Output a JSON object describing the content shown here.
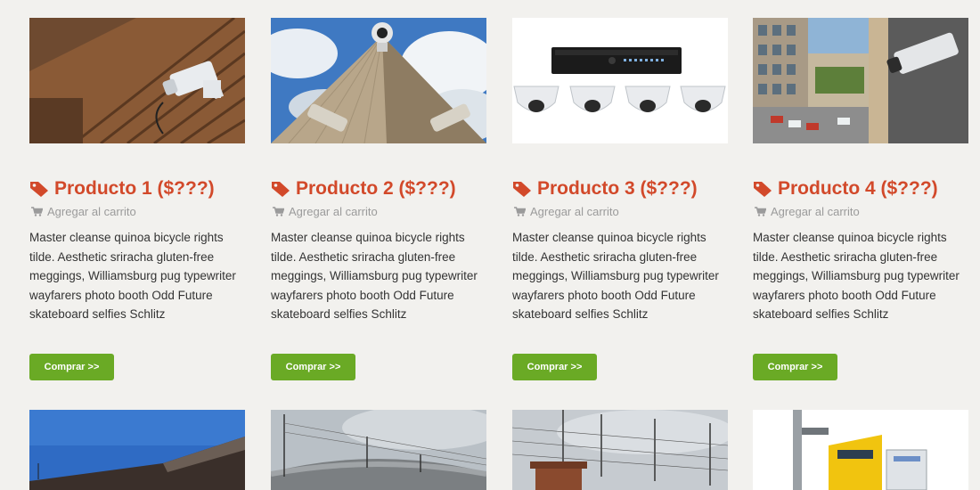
{
  "products": [
    {
      "title": "Producto 1 ($???)",
      "cart_label": "Agregar al carrito",
      "description": "Master cleanse quinoa bicycle rights tilde. Aesthetic sriracha gluten-free meggings, Williamsburg pug typewriter wayfarers photo booth Odd Future skateboard selfies Schlitz",
      "button_label": "Comprar >>",
      "image": "wall-mounted-security-camera"
    },
    {
      "title": "Producto 2 ($???)",
      "cart_label": "Agregar al carrito",
      "description": "Master cleanse quinoa bicycle rights tilde. Aesthetic sriracha gluten-free meggings, Williamsburg pug typewriter wayfarers photo booth Odd Future skateboard selfies Schlitz",
      "button_label": "Comprar >>",
      "image": "rooftop-cameras-sky"
    },
    {
      "title": "Producto 3 ($???)",
      "cart_label": "Agregar al carrito",
      "description": "Master cleanse quinoa bicycle rights tilde. Aesthetic sriracha gluten-free meggings, Williamsburg pug typewriter wayfarers photo booth Odd Future skateboard selfies Schlitz",
      "button_label": "Comprar >>",
      "image": "dvr-kit-dome-cameras"
    },
    {
      "title": "Producto 4 ($???)",
      "cart_label": "Agregar al carrito",
      "description": "Master cleanse quinoa bicycle rights tilde. Aesthetic sriracha gluten-free meggings, Williamsburg pug typewriter wayfarers photo booth Odd Future skateboard selfies Schlitz",
      "button_label": "Comprar >>",
      "image": "street-camera-building"
    }
  ],
  "second_row_images": [
    "building-roof-blue-sky",
    "electric-fence-cloudy",
    "electric-fence-wall",
    "warning-sign-pole"
  ],
  "colors": {
    "background": "#f2f1ee",
    "title": "#d2492a",
    "cart_link": "#9b9b9b",
    "description": "#333333",
    "button": "#6aaa25",
    "button_text": "#ffffff"
  },
  "icons": {
    "title": "price-tag-icon",
    "cart": "shopping-cart-icon"
  }
}
